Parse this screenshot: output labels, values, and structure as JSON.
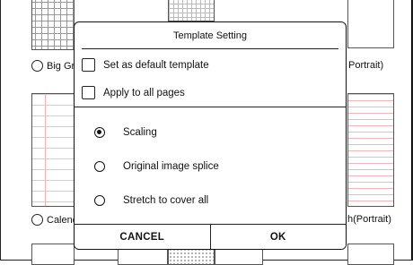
{
  "background_templates": {
    "top_left_label": "Big Gr",
    "top_right_label": "Portrait)",
    "mid_left_label": "Calend",
    "mid_right_label": "h(Portrait)"
  },
  "dialog": {
    "title": "Template Setting",
    "checkboxes": [
      {
        "label": "Set as default template",
        "checked": false
      },
      {
        "label": "Apply to all pages",
        "checked": false
      }
    ],
    "options": [
      {
        "label": "Scaling",
        "selected": true
      },
      {
        "label": "Original image splice",
        "selected": false
      },
      {
        "label": "Stretch to cover all",
        "selected": false
      }
    ],
    "cancel_label": "CANCEL",
    "ok_label": "OK"
  }
}
